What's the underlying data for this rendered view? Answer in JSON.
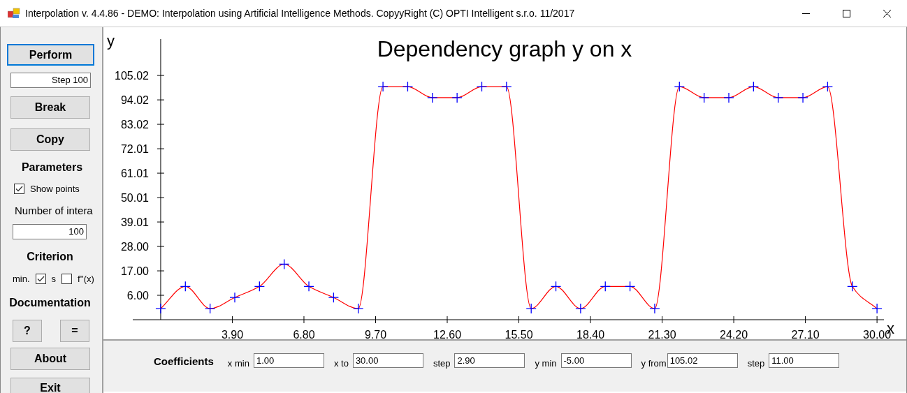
{
  "window": {
    "title": "Interpolation v. 4.4.86 - DEMO: Interpolation using Artificial Intelligence Methods. CopyyRight (C) OPTI Intelligent s.r.o. 11/2017"
  },
  "sidebar": {
    "perform_button": {
      "label": "Perform",
      "focused": true
    },
    "step_field": {
      "value": "Step 100"
    },
    "break_button": {
      "label": "Break"
    },
    "copy_button": {
      "label": "Copy"
    },
    "parameters": {
      "heading": "Parameters",
      "show_points": {
        "label": "Show points",
        "checked": true
      },
      "iterations_label": "Number of intera",
      "iterations_field": {
        "value": "100"
      }
    },
    "criterion": {
      "heading": "Criterion",
      "prefix": "min.",
      "options": [
        {
          "label": "s",
          "checked": true
        },
        {
          "label": "f''(x)",
          "checked": false
        }
      ]
    },
    "documentation": {
      "heading": "Documentation",
      "buttons": [
        "?",
        "="
      ]
    },
    "about_button": {
      "label": "About"
    },
    "exit_button": {
      "label": "Exit"
    }
  },
  "chart": {
    "chart_data": {
      "type": "line",
      "title": "Dependency graph y on x",
      "xlabel": "x",
      "ylabel": "y",
      "x": [
        1,
        2,
        3,
        4,
        5,
        6,
        7,
        8,
        9,
        10,
        11,
        12,
        13,
        14,
        15,
        16,
        17,
        18,
        19,
        20,
        21,
        22,
        23,
        24,
        25,
        26,
        27,
        28,
        29,
        30
      ],
      "series": [
        {
          "color": "#ff0000",
          "marker": "plus",
          "values": [
            0,
            10,
            0,
            5,
            10,
            20,
            10,
            5,
            0,
            100,
            100,
            95,
            95,
            100,
            100,
            0,
            10,
            0,
            10,
            10,
            0,
            100,
            95,
            95,
            100,
            95,
            95,
            100,
            10,
            0
          ]
        }
      ],
      "xlim": [
        -0.13,
        30.28
      ],
      "ylim": [
        -5,
        121.4
      ],
      "xticks": [
        {
          "value": 3.9,
          "label": "3.90"
        },
        {
          "value": 6.8,
          "label": "6.80"
        },
        {
          "value": 9.7,
          "label": "9.70"
        },
        {
          "value": 12.6,
          "label": "12.60"
        },
        {
          "value": 15.5,
          "label": "15.50"
        },
        {
          "value": 18.4,
          "label": "18.40"
        },
        {
          "value": 21.3,
          "label": "21.30"
        },
        {
          "value": 24.2,
          "label": "24.20"
        },
        {
          "value": 27.1,
          "label": "27.10"
        },
        {
          "value": 30,
          "label": "30.00"
        }
      ],
      "yticks": [
        {
          "value": 6,
          "label": "6.00"
        },
        {
          "value": 17,
          "label": "17.00"
        },
        {
          "value": 28,
          "label": "28.00"
        },
        {
          "value": 39.01,
          "label": "39.01"
        },
        {
          "value": 50.01,
          "label": "50.01"
        },
        {
          "value": 61.01,
          "label": "61.01"
        },
        {
          "value": 72.01,
          "label": "72.01"
        },
        {
          "value": 83.02,
          "label": "83.02"
        },
        {
          "value": 94.02,
          "label": "94.02"
        },
        {
          "value": 105.02,
          "label": "105.02"
        }
      ]
    }
  },
  "coefficients": {
    "heading": "Coefficients",
    "fields": [
      {
        "label": "x min",
        "value": "1.00"
      },
      {
        "label": "x to",
        "value": "30.00"
      },
      {
        "label": "step",
        "value": "2.90"
      },
      {
        "label": "y min",
        "value": "-5.00"
      },
      {
        "label": "y from",
        "value": "105.02"
      },
      {
        "label": "step",
        "value": "11.00"
      }
    ]
  }
}
